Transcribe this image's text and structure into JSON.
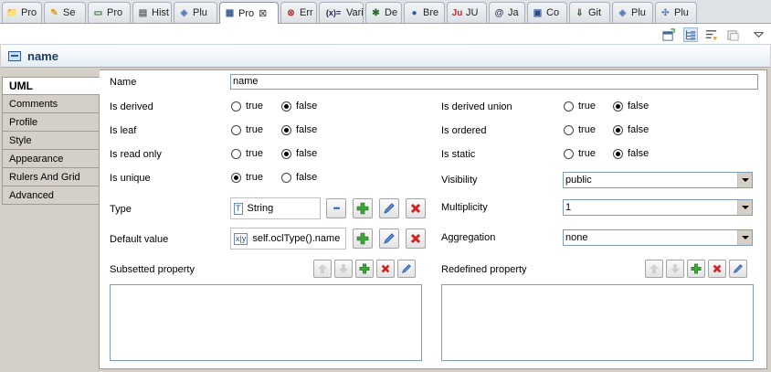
{
  "tabs": [
    {
      "label": "Pro",
      "icon": "project-icon"
    },
    {
      "label": "Se",
      "icon": "search-icon"
    },
    {
      "label": "Pro",
      "icon": "progress-icon"
    },
    {
      "label": "Hist",
      "icon": "history-icon"
    },
    {
      "label": "Plu",
      "icon": "plugins-icon"
    },
    {
      "label": "Pro",
      "icon": "properties-icon",
      "close": "⊠"
    },
    {
      "label": "Err",
      "icon": "error-log-icon"
    },
    {
      "label": "Vari",
      "icon": "variables-icon"
    },
    {
      "label": "De",
      "icon": "debug-icon"
    },
    {
      "label": "Bre",
      "icon": "breakpoints-icon"
    },
    {
      "label": "JU",
      "icon": "junit-icon"
    },
    {
      "label": "Ja",
      "icon": "javadoc-icon"
    },
    {
      "label": "Co",
      "icon": "console-icon"
    },
    {
      "label": "Git",
      "icon": "git-icon"
    },
    {
      "label": "Plu",
      "icon": "plugins-icon"
    },
    {
      "label": "Plu",
      "icon": "plugin-dependencies-icon"
    }
  ],
  "title": "name",
  "side_tabs": [
    "UML",
    "Comments",
    "Profile",
    "Style",
    "Appearance",
    "Rulers And Grid",
    "Advanced"
  ],
  "form": {
    "name_label": "Name",
    "name_value": "name",
    "true_label": "true",
    "false_label": "false",
    "is_derived_label": "Is derived",
    "is_leaf_label": "Is leaf",
    "is_read_only_label": "Is read only",
    "is_unique_label": "Is unique",
    "is_derived_union_label": "Is derived union",
    "is_ordered_label": "Is ordered",
    "is_static_label": "Is static",
    "visibility_label": "Visibility",
    "visibility_value": "public",
    "type_label": "Type",
    "type_value": "String",
    "type_icon_text": "T",
    "multiplicity_label": "Multiplicity",
    "multiplicity_value": "1",
    "default_value_label": "Default value",
    "default_value_value": "self.oclType().name",
    "default_icon_text": "x|y",
    "aggregation_label": "Aggregation",
    "aggregation_value": "none",
    "browse_label": "•••",
    "subsetted_label": "Subsetted property",
    "redefined_label": "Redefined property"
  },
  "radio_states": {
    "is_derived": false,
    "is_leaf": false,
    "is_read_only": false,
    "is_unique": true,
    "is_derived_union": false,
    "is_ordered": false,
    "is_static": false
  },
  "colors": {
    "add": "#3ea33a",
    "delete": "#d42020",
    "edit": "#2a5fb0",
    "title": "#1f3a66"
  }
}
